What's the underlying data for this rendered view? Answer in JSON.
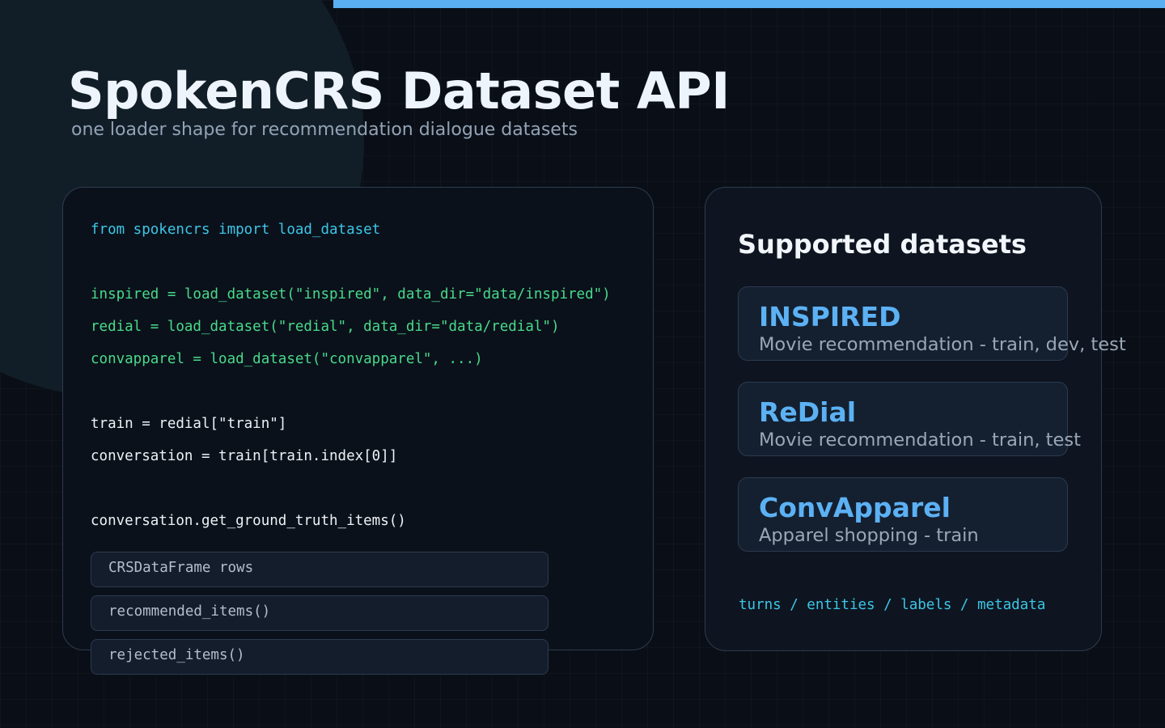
{
  "header": {
    "title": "SpokenCRS Dataset API",
    "subtitle": "one loader shape for recommendation dialogue datasets"
  },
  "code": {
    "import_line": "from spokencrs import load_dataset",
    "load_lines": [
      "inspired = load_dataset(\"inspired\", data_dir=\"data/inspired\")",
      "redial = load_dataset(\"redial\", data_dir=\"data/redial\")",
      "convapparel = load_dataset(\"convapparel\", ...)"
    ],
    "access_lines": [
      "train = redial[\"train\"]",
      "conversation = train[train.index[0]]"
    ],
    "call_line": "conversation.get_ground_truth_items()",
    "methods": [
      "CRSDataFrame rows",
      "recommended_items()",
      "rejected_items()"
    ]
  },
  "datasets_panel": {
    "heading": "Supported datasets",
    "items": [
      {
        "name": "INSPIRED",
        "description": "Movie recommendation - train, dev, test"
      },
      {
        "name": "ReDial",
        "description": "Movie recommendation - train, test"
      },
      {
        "name": "ConvApparel",
        "description": "Apparel shopping - train"
      }
    ],
    "fields_line": "turns / entities / labels / metadata"
  },
  "colors": {
    "accent_bar": "#5aaef2",
    "dataset_name": "#5cb1f4",
    "code_import": "#3cc6e6",
    "code_loader": "#48da8a"
  }
}
